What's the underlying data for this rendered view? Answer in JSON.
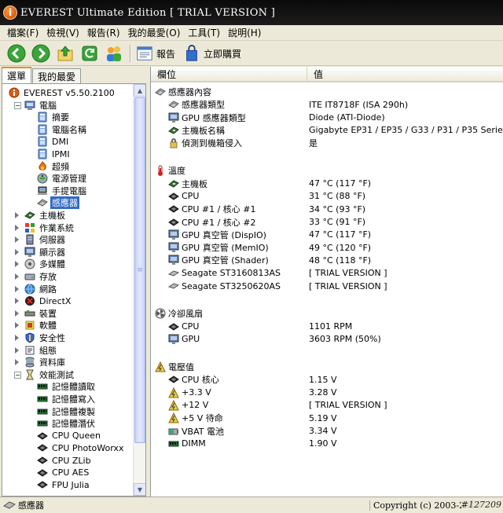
{
  "window": {
    "title": "EVEREST Ultimate Edition  [ TRIAL VERSION ]"
  },
  "menu": [
    "檔案(F)",
    "檢視(V)",
    "報告(R)",
    "我的最愛(O)",
    "工具(T)",
    "說明(H)"
  ],
  "toolbar": {
    "report_label": "報告",
    "buy_label": "立即購買"
  },
  "left_tabs": [
    "選單",
    "我的最愛"
  ],
  "tree": [
    {
      "label": "EVEREST v5.50.2100",
      "icon": "everest-icon",
      "indent": 0,
      "exp": "none"
    },
    {
      "label": "電腦",
      "icon": "computer-icon",
      "indent": 1,
      "exp": "minus"
    },
    {
      "label": "摘要",
      "icon": "info-icon",
      "indent": 2,
      "exp": "none"
    },
    {
      "label": "電腦名稱",
      "icon": "info-icon",
      "indent": 2,
      "exp": "none"
    },
    {
      "label": "DMI",
      "icon": "info-icon",
      "indent": 2,
      "exp": "none"
    },
    {
      "label": "IPMI",
      "icon": "info-icon",
      "indent": 2,
      "exp": "none"
    },
    {
      "label": "超頻",
      "icon": "overclock-icon",
      "indent": 2,
      "exp": "none"
    },
    {
      "label": "電源管理",
      "icon": "power-icon",
      "indent": 2,
      "exp": "none"
    },
    {
      "label": "手提電腦",
      "icon": "laptop-icon",
      "indent": 2,
      "exp": "none"
    },
    {
      "label": "感應器",
      "icon": "sensor-icon",
      "indent": 2,
      "exp": "none",
      "selected": true
    },
    {
      "label": "主機板",
      "icon": "motherboard-icon",
      "indent": 1,
      "exp": "plus"
    },
    {
      "label": "作業系統",
      "icon": "windows-icon",
      "indent": 1,
      "exp": "plus"
    },
    {
      "label": "伺服器",
      "icon": "server-icon",
      "indent": 1,
      "exp": "plus"
    },
    {
      "label": "顯示器",
      "icon": "display-icon",
      "indent": 1,
      "exp": "plus"
    },
    {
      "label": "多媒體",
      "icon": "multimedia-icon",
      "indent": 1,
      "exp": "plus"
    },
    {
      "label": "存放",
      "icon": "storage-icon",
      "indent": 1,
      "exp": "plus"
    },
    {
      "label": "網路",
      "icon": "network-icon",
      "indent": 1,
      "exp": "plus"
    },
    {
      "label": "DirectX",
      "icon": "directx-icon",
      "indent": 1,
      "exp": "plus"
    },
    {
      "label": "裝置",
      "icon": "devices-icon",
      "indent": 1,
      "exp": "plus"
    },
    {
      "label": "軟體",
      "icon": "software-icon",
      "indent": 1,
      "exp": "plus"
    },
    {
      "label": "安全性",
      "icon": "security-icon",
      "indent": 1,
      "exp": "plus"
    },
    {
      "label": "組態",
      "icon": "config-icon",
      "indent": 1,
      "exp": "plus"
    },
    {
      "label": "資料庫",
      "icon": "database-icon",
      "indent": 1,
      "exp": "plus"
    },
    {
      "label": "效能測試",
      "icon": "benchmark-icon",
      "indent": 1,
      "exp": "minus"
    },
    {
      "label": "記憶體讀取",
      "icon": "memory-icon",
      "indent": 2,
      "exp": "none"
    },
    {
      "label": "記憶體寫入",
      "icon": "memory-icon",
      "indent": 2,
      "exp": "none"
    },
    {
      "label": "記憶體複製",
      "icon": "memory-icon",
      "indent": 2,
      "exp": "none"
    },
    {
      "label": "記憶體潛伏",
      "icon": "memory-icon",
      "indent": 2,
      "exp": "none"
    },
    {
      "label": "CPU Queen",
      "icon": "cpu-icon",
      "indent": 2,
      "exp": "none"
    },
    {
      "label": "CPU PhotoWorxx",
      "icon": "cpu-icon",
      "indent": 2,
      "exp": "none"
    },
    {
      "label": "CPU ZLib",
      "icon": "cpu-icon",
      "indent": 2,
      "exp": "none"
    },
    {
      "label": "CPU AES",
      "icon": "cpu-icon",
      "indent": 2,
      "exp": "none"
    },
    {
      "label": "FPU Julia",
      "icon": "cpu-icon",
      "indent": 2,
      "exp": "none"
    }
  ],
  "columns": {
    "field": "欄位",
    "value": "值"
  },
  "sections": [
    {
      "title": "感應器內容",
      "icon": "sensor-icon",
      "rows": [
        {
          "field": "感應器類型",
          "value": "ITE IT8718F  (ISA 290h)",
          "icon": "sensor-icon"
        },
        {
          "field": "GPU 感應器類型",
          "value": "Diode  (ATI-Diode)",
          "icon": "display-icon"
        },
        {
          "field": "主機板名稱",
          "value": "Gigabyte EP31 / EP35 / G33 / P31 / P35 Series",
          "icon": "motherboard-icon"
        },
        {
          "field": "偵測到機箱侵入",
          "value": "是",
          "icon": "lock-icon"
        }
      ]
    },
    {
      "title": "溫度",
      "icon": "thermometer-icon",
      "rows": [
        {
          "field": "主機板",
          "value": "47 °C  (117 °F)",
          "icon": "motherboard-icon"
        },
        {
          "field": "CPU",
          "value": "31 °C  (88 °F)",
          "icon": "cpu-icon"
        },
        {
          "field": "CPU #1 / 核心 #1",
          "value": "34 °C  (93 °F)",
          "icon": "cpu-icon"
        },
        {
          "field": "CPU #1 / 核心 #2",
          "value": "33 °C  (91 °F)",
          "icon": "cpu-icon"
        },
        {
          "field": "GPU 真空管 (DispIO)",
          "value": "47 °C  (117 °F)",
          "icon": "display-icon"
        },
        {
          "field": "GPU 真空管 (MemIO)",
          "value": "49 °C  (120 °F)",
          "icon": "display-icon"
        },
        {
          "field": "GPU 真空管 (Shader)",
          "value": "48 °C  (118 °F)",
          "icon": "display-icon"
        },
        {
          "field": "Seagate ST3160813AS",
          "value": "[ TRIAL VERSION ]",
          "icon": "hdd-icon"
        },
        {
          "field": "Seagate ST3250620AS",
          "value": "[ TRIAL VERSION ]",
          "icon": "hdd-icon"
        }
      ]
    },
    {
      "title": "冷卻風扇",
      "icon": "fan-icon",
      "rows": [
        {
          "field": "CPU",
          "value": "1101 RPM",
          "icon": "cpu-icon"
        },
        {
          "field": "GPU",
          "value": "3603 RPM  (50%)",
          "icon": "display-icon"
        }
      ]
    },
    {
      "title": "電壓值",
      "icon": "voltage-icon",
      "rows": [
        {
          "field": "CPU 核心",
          "value": "1.15 V",
          "icon": "cpu-icon"
        },
        {
          "field": "+3.3 V",
          "value": "3.28 V",
          "icon": "voltage-icon"
        },
        {
          "field": "+12 V",
          "value": "[ TRIAL VERSION ]",
          "icon": "voltage-icon"
        },
        {
          "field": "+5 V 待命",
          "value": "5.19 V",
          "icon": "voltage-icon"
        },
        {
          "field": "VBAT 電池",
          "value": "3.34 V",
          "icon": "battery-icon"
        },
        {
          "field": "DIMM",
          "value": "1.90 V",
          "icon": "memory-icon"
        }
      ]
    }
  ],
  "status": {
    "selected": "感應器",
    "copyright": "Copyright (c) 2003-2010",
    "watermark": "#127209"
  }
}
